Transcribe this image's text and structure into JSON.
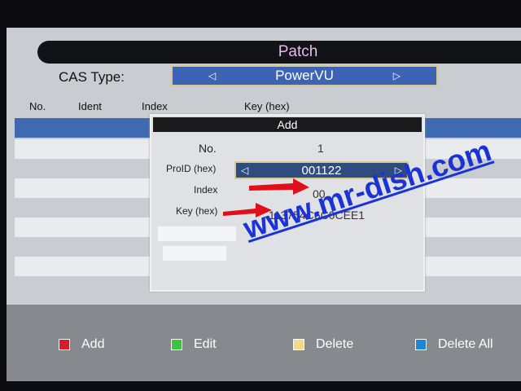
{
  "title": "Patch",
  "cas": {
    "label": "CAS Type:",
    "value": "PowerVU",
    "left_arrow": "◁",
    "right_arrow": "▷"
  },
  "table": {
    "headers": [
      "No.",
      "Ident",
      "Index",
      "Key (hex)"
    ]
  },
  "dialog": {
    "title": "Add",
    "no_label": "No.",
    "no_value": "1",
    "provid_label": "ProID (hex)",
    "provid_value": "001122",
    "index_label": "Index",
    "index_value": "00",
    "key_label": "Key (hex)",
    "key_value": "113754C6C0CEE1"
  },
  "watermark": "www.mr-dish.com",
  "footer": {
    "add": {
      "label": "Add",
      "color": "#d21f2a"
    },
    "edit": {
      "label": "Edit",
      "color": "#3fc43f"
    },
    "delete": {
      "label": "Delete",
      "color": "#f3d98b"
    },
    "delete_all": {
      "label": "Delete All",
      "color": "#1e86d6"
    }
  },
  "colors": {
    "selection": "#3f6aaf",
    "arrow": "#e0101a",
    "watermark": "#1933d6"
  }
}
